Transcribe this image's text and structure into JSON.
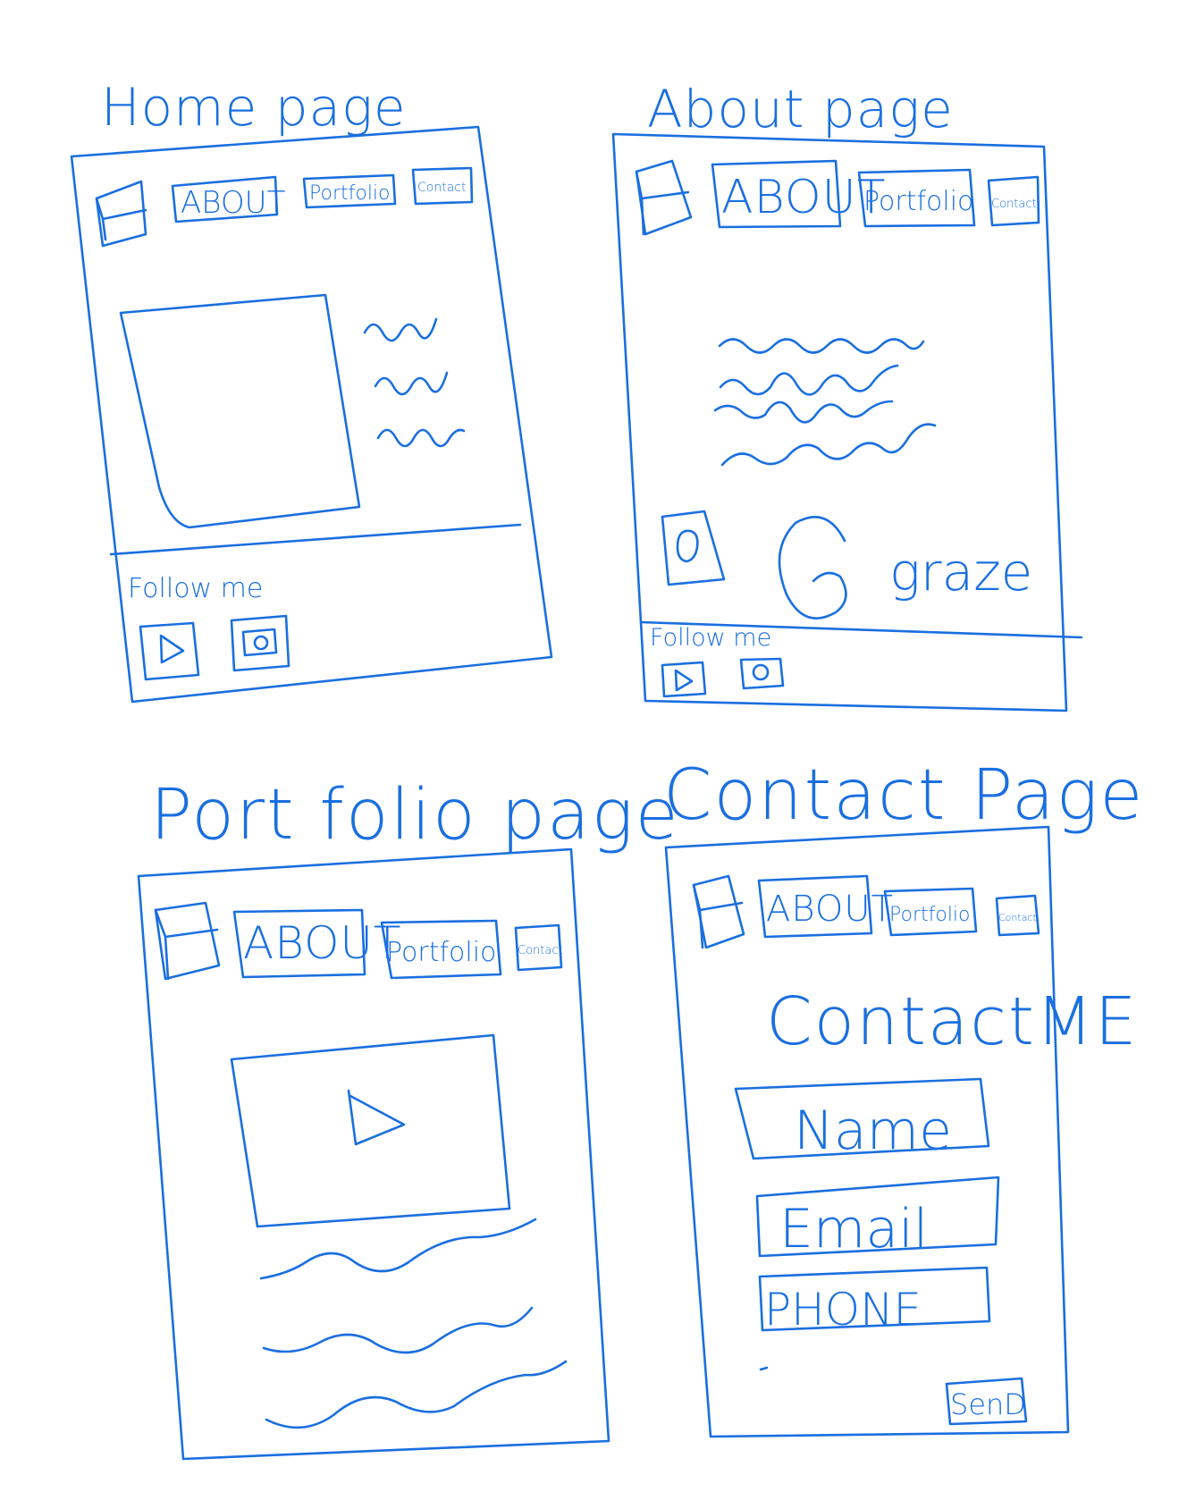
{
  "colors": {
    "ink": "#1a6fe0",
    "background": "#ffffff"
  },
  "home": {
    "title": "Home page",
    "nav": {
      "about": "ABOUT",
      "portfolio": "Portfolio",
      "contact": "Contact"
    },
    "footer": {
      "label": "Follow me",
      "icons": [
        "play-icon",
        "camera-icon"
      ]
    }
  },
  "about": {
    "title": "About page",
    "nav": {
      "about": "ABOUT",
      "portfolio": "Portfolio",
      "contact": "Contact"
    },
    "brand": "graze",
    "footer": {
      "label": "Follow me",
      "icons": [
        "play-icon",
        "camera-icon"
      ]
    }
  },
  "portfolio": {
    "title": "Port folio page",
    "nav": {
      "about": "ABOUT",
      "portfolio": "Portfolio",
      "contact": "Contact"
    },
    "video_icon": "play-icon"
  },
  "contact": {
    "title": "Contact Page",
    "nav": {
      "about": "ABOUT",
      "portfolio": "Portfolio",
      "contact": "Contact"
    },
    "heading": "ContactME",
    "fields": {
      "name": "Name",
      "email": "Email",
      "phone": "PHONE"
    },
    "send": "SenD"
  }
}
